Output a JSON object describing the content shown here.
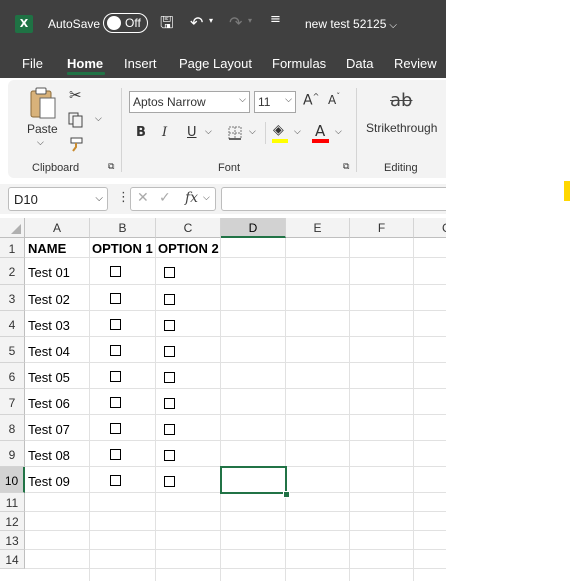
{
  "titlebar": {
    "app_icon": "excel-logo-icon",
    "app_icon_glyph": "X",
    "autosave_label": "AutoSave",
    "autosave_state": "Off",
    "save_icon_glyph": "🖫",
    "undo_icon_glyph": "↶",
    "redo_icon_glyph": "↷",
    "qat_menu_glyph": "≡",
    "doc_title": "new test 52125"
  },
  "menu": {
    "tabs": [
      "File",
      "Home",
      "Insert",
      "Page Layout",
      "Formulas",
      "Data",
      "Review"
    ],
    "active_tab": "Home"
  },
  "ribbon": {
    "clipboard": {
      "paste_label": "Paste",
      "cut_icon": "scissors-icon",
      "copy_icon": "copy-icon",
      "format_painter_icon": "brush-icon",
      "group_label": "Clipboard"
    },
    "font": {
      "font_name": "Aptos Narrow",
      "font_size": "11",
      "grow_glyph": "A^",
      "shrink_glyph": "Aˇ",
      "bold": "B",
      "italic": "I",
      "underline": "U",
      "borders_icon": "borders-icon",
      "fill_glyph": "◈",
      "fill_color": "#ffff00",
      "font_color_glyph": "A",
      "font_color": "#ff0000",
      "group_label": "Font"
    },
    "editing": {
      "strike_glyph": "ab",
      "strikethrough_label": "Strikethrough",
      "group_label": "Editing"
    }
  },
  "formula_bar": {
    "name_box": "D10",
    "cancel_glyph": "✕",
    "enter_glyph": "✓",
    "fx_label": "fx",
    "formula": ""
  },
  "sheet": {
    "columns": [
      "A",
      "B",
      "C",
      "D",
      "E",
      "F",
      "G"
    ],
    "selected_column": "D",
    "rows": [
      "1",
      "2",
      "3",
      "4",
      "5",
      "6",
      "7",
      "8",
      "9",
      "10",
      "11",
      "12",
      "13",
      "14"
    ],
    "selected_row": "10",
    "header_row": [
      "NAME",
      "OPTION 1",
      "OPTION 2"
    ],
    "names": [
      "Test 01",
      "Test 02",
      "Test 03",
      "Test 04",
      "Test 05",
      "Test 06",
      "Test 07",
      "Test 08",
      "Test 09"
    ],
    "option1_checked": [
      false,
      false,
      false,
      false,
      false,
      false,
      false,
      false,
      false
    ],
    "option2_checked": [
      false,
      false,
      false,
      false,
      false,
      false,
      false,
      false,
      false
    ],
    "active_cell": "D10"
  }
}
